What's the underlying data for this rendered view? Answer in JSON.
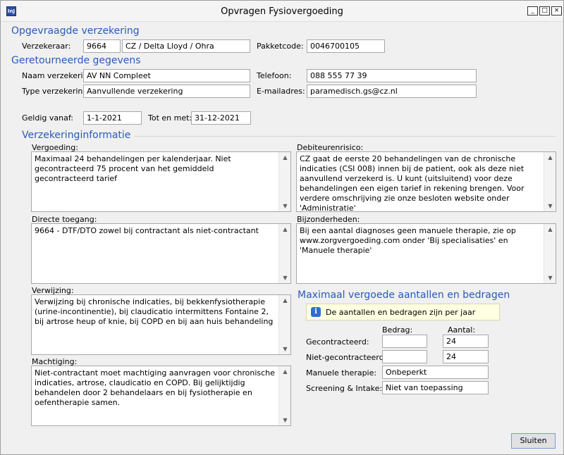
{
  "window": {
    "title": "Opvragen Fysiovergoeding",
    "app_icon": "InJ",
    "min": "_",
    "max": "□",
    "close": "×"
  },
  "opgevraagde": {
    "heading": "Opgevraagde verzekering",
    "verzekeraar_label": "Verzekeraar:",
    "verzekeraar_code": "9664",
    "verzekeraar_name": "CZ / Delta Lloyd / Ohra",
    "pakketcode_label": "Pakketcode:",
    "pakketcode": "0046700105"
  },
  "geretourneerde": {
    "heading": "Geretourneerde gegevens",
    "naam_label": "Naam verzekering:",
    "naam": "AV NN Compleet",
    "type_label": "Type verzekering:",
    "type": "Aanvullende verzekering",
    "telefoon_label": "Telefoon:",
    "telefoon": "088 555 77 39",
    "email_label": "E-mailadres:",
    "email": "paramedisch.gs@cz.nl",
    "geldig_label": "Geldig vanaf:",
    "geldig": "1-1-2021",
    "tot_label": "Tot en met:",
    "tot": "31-12-2021"
  },
  "info": {
    "heading": "Verzekeringinformatie",
    "vergoeding_label": "Vergoeding:",
    "vergoeding_ul": "o",
    "vergoeding": "Maximaal 24 behandelingen per kalenderjaar.  Niet gecontracteerd 75 procent van het gemiddeld gecontracteerd tarief",
    "debiteur_label": "Debiteurenrisico:",
    "debiteur": "CZ gaat de eerste 20 behandelingen van de chronische indicaties (CSI 008) innen bij de patient, ook als deze niet aanvullend verzekerd is. U kunt (uitsluitend) voor deze behandelingen een eigen tarief in rekening brengen. Voor verdere omschrijving zie onze besloten website onder 'Administratie'",
    "directe_label": "Directe toegang:",
    "directe": "9664 - DTF/DTO zowel bij contractant als niet-contractant",
    "bijzonderheden_label": "Bijzonderheden:",
    "bijzonderheden": "Bij een aantal diagnoses geen manuele therapie, zie op www.zorgvergoeding.com onder 'Bij specialisaties' en 'Manuele therapie'",
    "verwijzing_label": "Verwijzing:",
    "verwijzing": "Verwijzing bij chronische indicaties, bij bekkenfysiotherapie (urine-incontinentie), bij claudicatio intermittens Fontaine 2, bij artrose heup of knie, bij COPD en bij aan huis behandeling",
    "machtiging_label": "Machtiging:",
    "machtiging": "Niet-contractant moet machtiging aanvragen voor chronische indicaties, artrose, claudicatio en COPD. Bij gelijktijdig behandelen door 2 behandelaars en bij fysiotherapie en oefentherapie samen."
  },
  "maximaal": {
    "heading": "Maximaal vergoede aantallen en bedragen",
    "notice": "De aantallen en bedragen zijn per jaar",
    "bedrag_header": "Bedrag:",
    "aantal_header": "Aantal:",
    "gecontracteerd_label": "Gecontracteerd:",
    "gecontracteerd_bedrag": "",
    "gecontracteerd_aantal": "24",
    "niet_label": "Niet-gecontracteerd:",
    "niet_bedrag": "",
    "niet_aantal": "24",
    "manuele_label": "Manuele therapie:",
    "manuele": "Onbeperkt",
    "screening_label": "Screening & Intake:",
    "screening": "Niet van toepassing"
  },
  "buttons": {
    "sluiten": "Sluiten"
  }
}
